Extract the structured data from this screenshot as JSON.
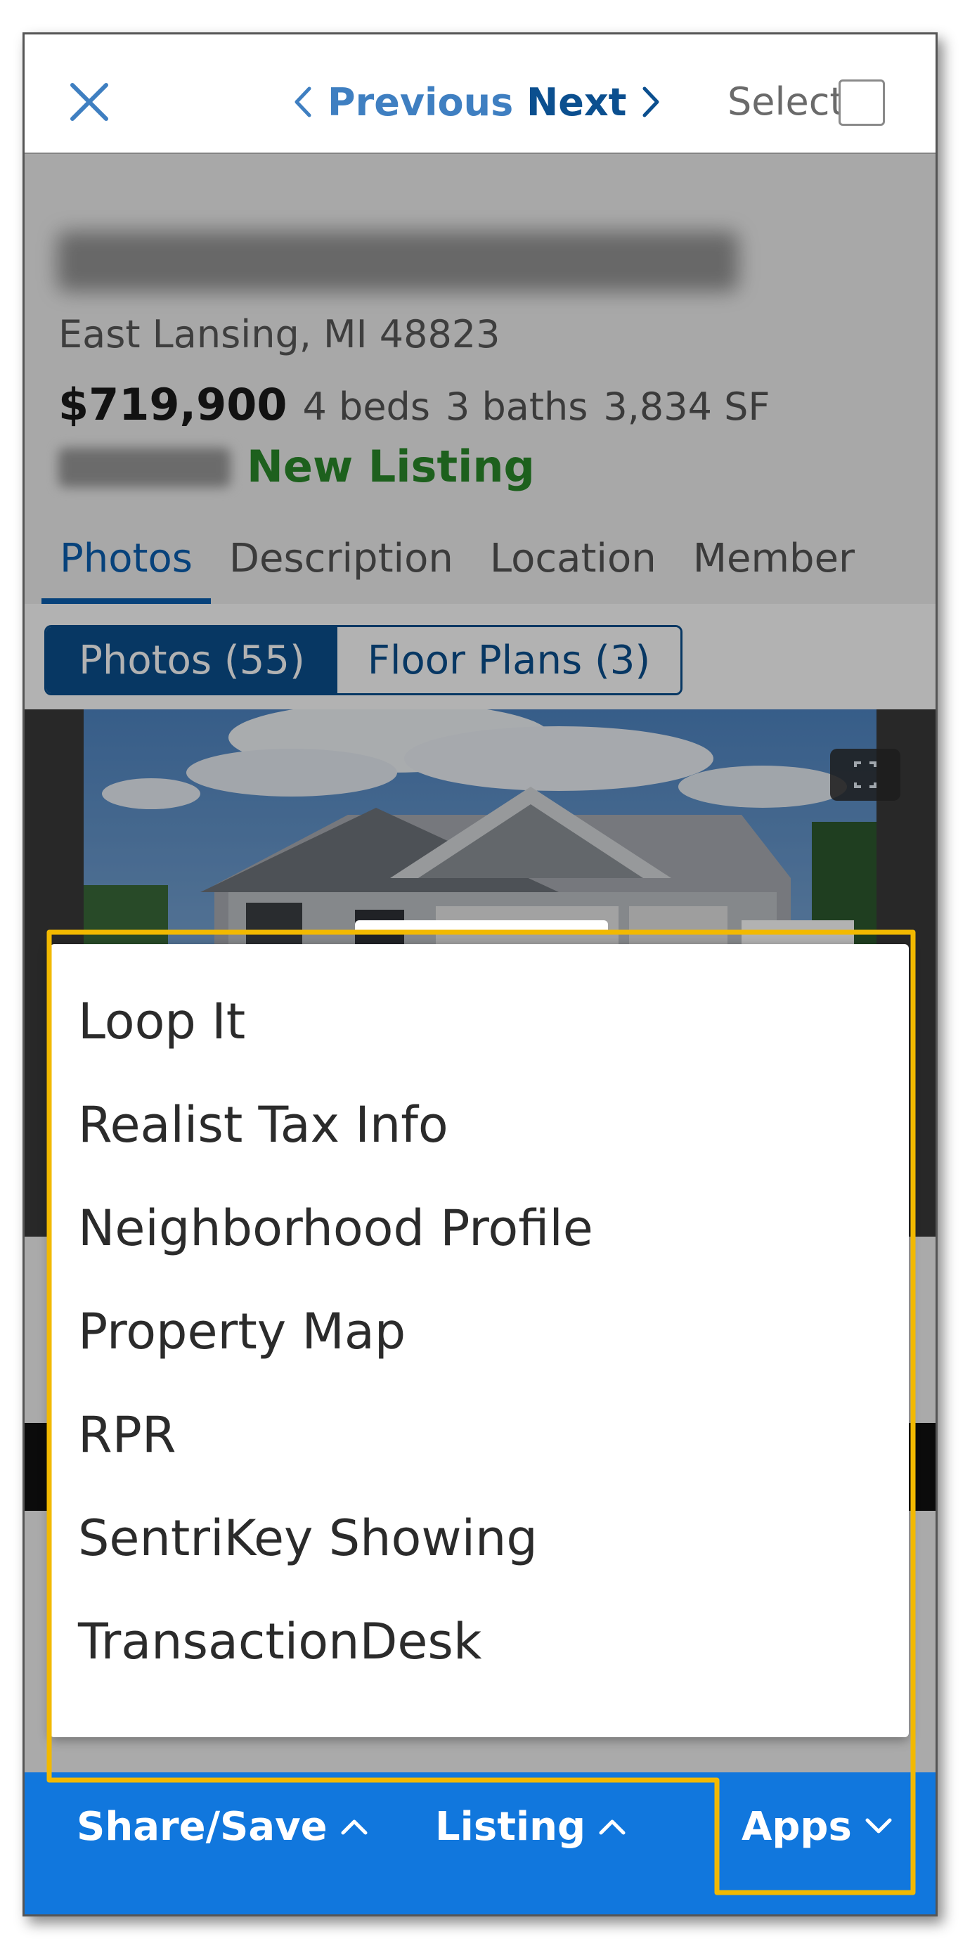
{
  "topbar": {
    "previous_label": "Previous",
    "next_label": "Next",
    "select_label": "Select"
  },
  "listing": {
    "city_line": "East Lansing, MI 48823",
    "price": "$719,900",
    "beds": "4 beds",
    "baths": "3 baths",
    "sqft": "3,834 SF",
    "status": "New Listing"
  },
  "tabs": [
    "Photos",
    "Description",
    "Location",
    "Member"
  ],
  "segments": {
    "photos": "Photos (55)",
    "floor_plans": "Floor Plans (3)"
  },
  "apps_menu": {
    "items": [
      "Loop It",
      "Realist Tax Info",
      "Neighborhood Profile",
      "Property Map",
      "RPR",
      "SentriKey Showing",
      "TransactionDesk"
    ]
  },
  "bottom_bar": {
    "share_save": "Share/Save",
    "listing": "Listing",
    "apps": "Apps"
  },
  "colors": {
    "bottom_bar": "#1177dd",
    "brand_dark_blue": "#0b4f8f",
    "link_blue": "#3f7fc1",
    "new_listing_green": "#2a8a2a",
    "highlight": "#f2b900"
  }
}
